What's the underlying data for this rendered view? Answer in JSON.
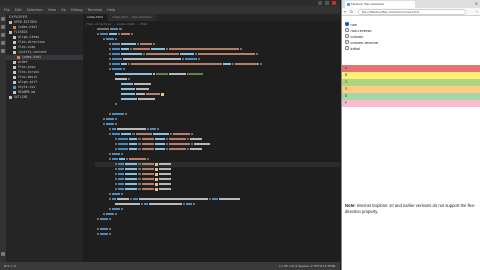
{
  "editor": {
    "menu": [
      "File",
      "Edit",
      "Selection",
      "View",
      "Go",
      "Debug",
      "Terminal",
      "Help"
    ],
    "sidebar": {
      "header": "EXPLORER",
      "items": [
        {
          "label": "OPEN EDITORS",
          "color": "#bbbbbb",
          "indent": 0
        },
        {
          "label": "index.html",
          "color": "#e37933",
          "indent": 1
        },
        {
          "label": "FLEXBOX",
          "color": "#bbbbbb",
          "indent": 0
        },
        {
          "label": "align-items",
          "color": "#c5c5c5",
          "indent": 1
        },
        {
          "label": "flex-direction",
          "color": "#c5c5c5",
          "indent": 1
        },
        {
          "label": "flex-wrap",
          "color": "#c5c5c5",
          "indent": 1
        },
        {
          "label": "justify-content",
          "color": "#c5c5c5",
          "indent": 1
        },
        {
          "label": "index.html",
          "color": "#e37933",
          "indent": 2,
          "selected": true
        },
        {
          "label": "order",
          "color": "#c5c5c5",
          "indent": 1
        },
        {
          "label": "flex-grow",
          "color": "#c5c5c5",
          "indent": 1
        },
        {
          "label": "flex-shrink",
          "color": "#c5c5c5",
          "indent": 1
        },
        {
          "label": "flex-basis",
          "color": "#c5c5c5",
          "indent": 1
        },
        {
          "label": "align-self",
          "color": "#c5c5c5",
          "indent": 1
        },
        {
          "label": "style.css",
          "color": "#519aba",
          "indent": 1
        },
        {
          "label": "README.md",
          "color": "#c5c5c5",
          "indent": 1
        },
        {
          "label": "OUTLINE",
          "color": "#bbbbbb",
          "indent": 0
        }
      ]
    },
    "tabs": [
      {
        "label": "index.html",
        "active": true
      },
      {
        "label": "index.html ~ flex-direction",
        "active": false
      }
    ],
    "breadcrumb": "flex-direction › index.html › html",
    "status_left": "⊗ 0  ⚠ 0",
    "status_right": "Ln 28, Col 9   Spaces: 2   UTF-8   LF   HTML"
  },
  "browser": {
    "tab_title": "Flexbox: flex-direction",
    "url": "file:///flexbox/flex-direction/index.html",
    "radios": [
      {
        "label": "row",
        "checked": true
      },
      {
        "label": "row-reverse",
        "checked": false
      },
      {
        "label": "column",
        "checked": false
      },
      {
        "label": "column-reverse",
        "checked": false
      },
      {
        "label": "initial",
        "checked": false
      }
    ],
    "flex_items": [
      {
        "label": "A",
        "color": "#e57373"
      },
      {
        "label": "B",
        "color": "#fff176"
      },
      {
        "label": "C",
        "color": "#aed581"
      },
      {
        "label": "D",
        "color": "#ffcc80"
      },
      {
        "label": "E",
        "color": "#a5d6a7"
      },
      {
        "label": "F",
        "color": "#f8bbd0"
      }
    ],
    "note_label": "Note:",
    "note_text": "Internet Explorer 10 and earlier versions do not support the flex-direction property."
  }
}
